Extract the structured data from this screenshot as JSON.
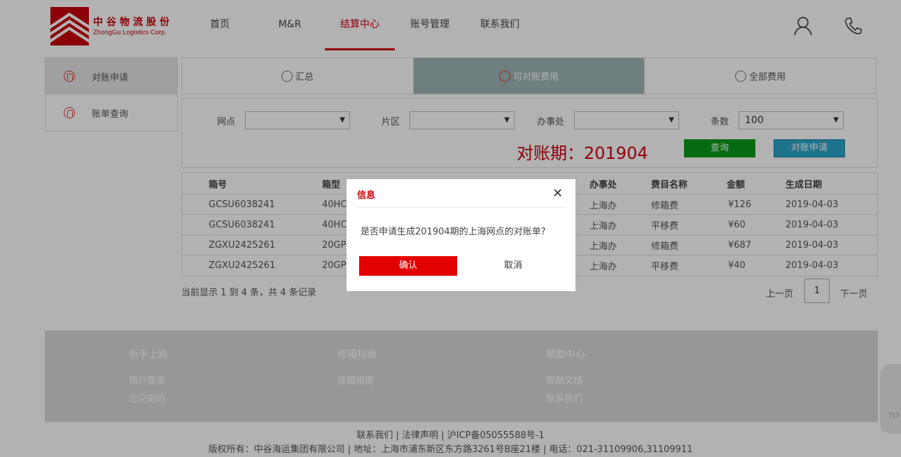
{
  "brand": {
    "name_cn": "中谷物流股份",
    "name_en": "ZhongGu Logistics Corp."
  },
  "nav": [
    {
      "label": "首页"
    },
    {
      "label": "M&R"
    },
    {
      "label": "结算中心"
    },
    {
      "label": "账号管理"
    },
    {
      "label": "联系我们"
    }
  ],
  "active_nav": "结算中心",
  "side_menu": [
    {
      "label": "对账申请",
      "active": true
    },
    {
      "label": "账单查询",
      "active": false
    }
  ],
  "tabs": [
    {
      "label": "汇总"
    },
    {
      "label": "可对账费用"
    },
    {
      "label": "全部费用"
    }
  ],
  "filters": {
    "outlet_label": "网点",
    "outlet_value": "",
    "area_label": "片区",
    "area_value": "",
    "office_label": "办事处",
    "office_value": "",
    "count_label": "条数",
    "count_value": "100"
  },
  "period_text": "对账期：201904",
  "buttons": {
    "query": "查询",
    "apply": "对账申请"
  },
  "table": {
    "headers": [
      "箱号",
      "箱型",
      "办事处",
      "费目名称",
      "金额",
      "生成日期"
    ],
    "rows": [
      [
        "GCSU6038241",
        "40HC",
        "上海办",
        "修箱费",
        "¥126",
        "2019-04-03"
      ],
      [
        "GCSU6038241",
        "40HC",
        "上海办",
        "平移费",
        "¥60",
        "2019-04-03"
      ],
      [
        "ZGXU2425261",
        "20GP",
        "上海办",
        "修箱费",
        "¥687",
        "2019-04-03"
      ],
      [
        "ZGXU2425261",
        "20GP",
        "上海办",
        "平移费",
        "¥40",
        "2019-04-03"
      ]
    ]
  },
  "pager": {
    "info": "当前显示 1 到 4 条，共 4 条记录",
    "prev": "上一页",
    "page": "1",
    "next": "下一页"
  },
  "footer": {
    "cols": [
      {
        "head": "新手上路",
        "links": [
          "用户登录",
          "忘记密码"
        ]
      },
      {
        "head": "修箱指南",
        "links": [
          "修箱指南"
        ]
      },
      {
        "head": "帮助中心",
        "links": [
          "帮助文档",
          "联系我们"
        ]
      }
    ],
    "line1": "联系我们 | 法律声明 | 沪ICP备05055588号-1",
    "line2": "版权所有：中谷海运集团有限公司 | 地址：上海市浦东新区东方路3261号B座21楼 | 电话：021-31109906,31109911"
  },
  "side_widget_text": "TO",
  "modal": {
    "title": "信息",
    "message": "是否申请生成201904期的上海网点的对账单?",
    "ok": "确认",
    "cancel": "取消"
  },
  "colors": {
    "brand_red": "#c7000b",
    "accent_red": "#d0000e",
    "query_green": "#09981a",
    "apply_blue": "#2aa5c9",
    "active_tab": "#9fb5b5"
  }
}
